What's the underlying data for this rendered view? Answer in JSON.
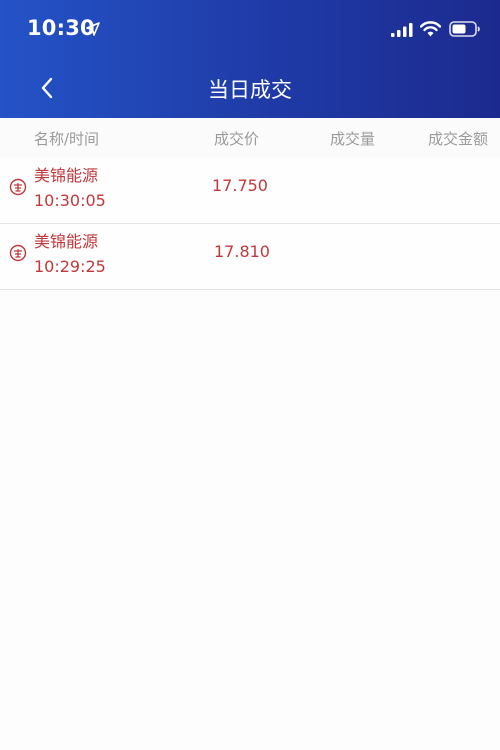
{
  "status_bar": {
    "time": "10:30",
    "icons": [
      "location-arrow-icon",
      "cellular-signal-icon",
      "wifi-icon",
      "battery-icon"
    ]
  },
  "nav": {
    "title": "当日成交",
    "back_icon": "chevron-left-icon"
  },
  "table": {
    "columns": [
      "名称/时间",
      "成交价",
      "成交量",
      "成交金额"
    ],
    "rows": [
      {
        "name": "美锦能源",
        "time": "10:30:05",
        "price": "17.750",
        "volume": "",
        "amount": "",
        "side_icon": "sell-stamp-icon"
      },
      {
        "name": "美锦能源",
        "time": "10:29:25",
        "price": "17.810",
        "volume": "",
        "amount": "",
        "side_icon": "sell-stamp-icon"
      }
    ]
  },
  "colors": {
    "header_start": "#2453c7",
    "header_end": "#1c2a8f",
    "sell_red": "#c0383c",
    "muted_text": "#9a9a9a"
  }
}
